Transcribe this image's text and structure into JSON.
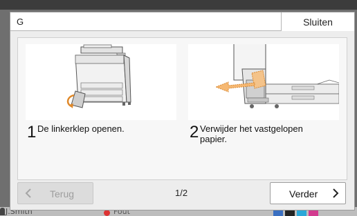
{
  "background": {
    "user_name": "J.Smith",
    "error_label": "Fout",
    "ink_colors": [
      "#3a6fc1",
      "#222222",
      "#2aa7d8",
      "#d23b8f"
    ]
  },
  "dialog": {
    "title": "G",
    "close_label": "Sluiten"
  },
  "steps": [
    {
      "number": "1",
      "text": "De linkerklep openen.",
      "icon": "printer-open-left-cover-illustration"
    },
    {
      "number": "2",
      "text": "Verwijder het vastgelopen papier.",
      "icon": "remove-jammed-paper-illustration"
    }
  ],
  "navigation": {
    "back_label": "Terug",
    "page_indicator": "1/2",
    "next_label": "Verder"
  }
}
